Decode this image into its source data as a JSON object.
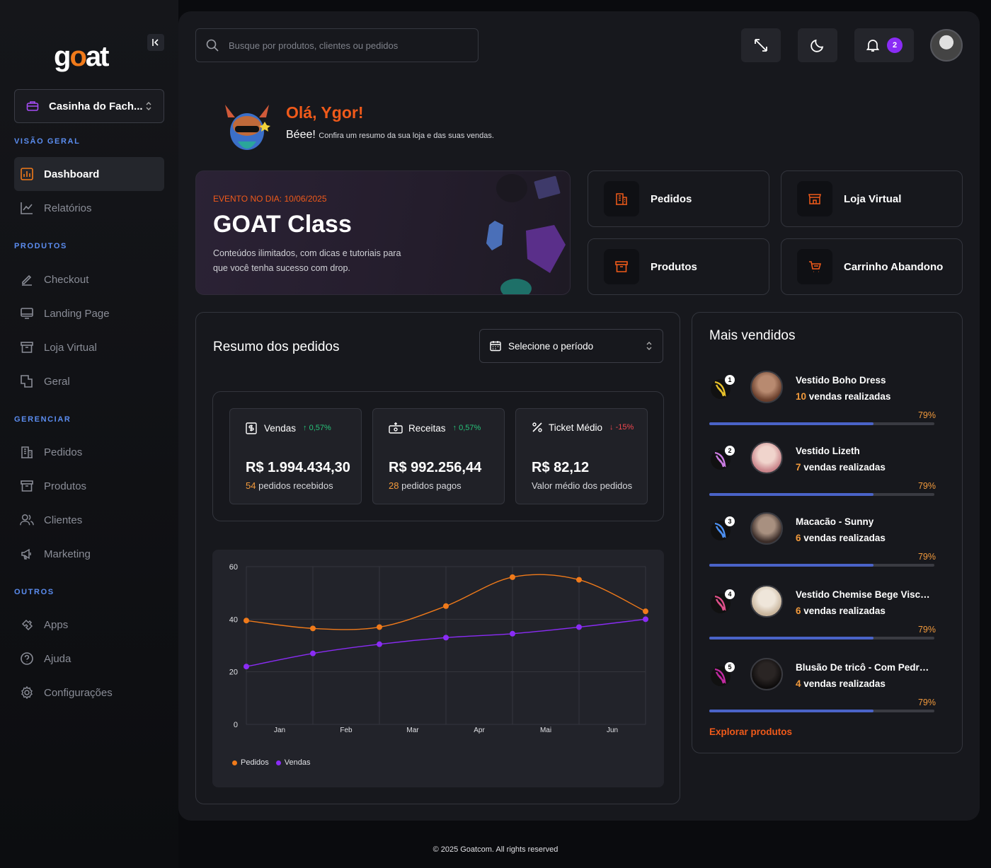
{
  "brand": {
    "logo_text": "goat",
    "logo_prefix": "g",
    "logo_o": "o",
    "logo_suffix": "at"
  },
  "store": {
    "name": "Casinha do Fach..."
  },
  "sidebar": {
    "sections": [
      "VISÃO GERAL",
      "PRODUTOS",
      "GERENCIAR",
      "OUTROS"
    ],
    "items": [
      {
        "label": "Dashboard",
        "icon": "bar-chart-icon"
      },
      {
        "label": "Relatórios",
        "icon": "line-chart-icon"
      },
      {
        "label": "Checkout",
        "icon": "pen-icon"
      },
      {
        "label": "Landing Page",
        "icon": "monitor-icon"
      },
      {
        "label": "Loja Virtual",
        "icon": "archive-icon"
      },
      {
        "label": "Geral",
        "icon": "squares-icon"
      },
      {
        "label": "Pedidos",
        "icon": "building-icon"
      },
      {
        "label": "Produtos",
        "icon": "archive-icon"
      },
      {
        "label": "Clientes",
        "icon": "users-icon"
      },
      {
        "label": "Marketing",
        "icon": "megaphone-icon"
      },
      {
        "label": "Apps",
        "icon": "puzzle-icon"
      },
      {
        "label": "Ajuda",
        "icon": "help-icon"
      },
      {
        "label": "Configurações",
        "icon": "gear-icon"
      }
    ]
  },
  "header": {
    "search_placeholder": "Busque por produtos, clientes ou pedidos",
    "notifications": "2"
  },
  "greeting": {
    "hello": "Olá, Ygor!",
    "bee": "Béee!",
    "sub": "Confira um resumo da sua loja e das suas vendas."
  },
  "event": {
    "tag": "EVENTO NO DIA: 10/06/2025",
    "title": "GOAT Class",
    "desc": "Conteúdos ilimitados, com dicas e tutoriais para que você tenha sucesso com drop."
  },
  "quick_links": [
    "Pedidos",
    "Loja Virtual",
    "Produtos",
    "Carrinho Abandono"
  ],
  "resumo": {
    "title": "Resumo dos pedidos",
    "period_placeholder": "Selecione o período",
    "stats": [
      {
        "label": "Vendas",
        "pct": "0,57%",
        "dir": "up",
        "value": "R$ 1.994.434,30",
        "count": "54",
        "note": "pedidos recebidos"
      },
      {
        "label": "Receitas",
        "pct": "0,57%",
        "dir": "up",
        "value": "R$ 992.256,44",
        "count": "28",
        "note": "pedidos pagos"
      },
      {
        "label": "Ticket Médio",
        "pct": "-15%",
        "dir": "down",
        "value": "R$ 82,12",
        "count": "",
        "note": "Valor médio dos pedidos"
      }
    ]
  },
  "chart_data": {
    "type": "line",
    "categories": [
      "Jan",
      "Feb",
      "Mar",
      "Apr",
      "Mai",
      "Jun"
    ],
    "ylim": [
      0,
      60
    ],
    "yticks": [
      0,
      20,
      40,
      60
    ],
    "x": [
      0,
      1,
      2,
      3,
      4,
      5,
      6
    ],
    "series": [
      {
        "name": "Pedidos",
        "color": "#f07a1a",
        "values": [
          39.5,
          36.5,
          37,
          45,
          56,
          55,
          43
        ]
      },
      {
        "name": "Vendas",
        "color": "#8a2cf5",
        "values": [
          22,
          27,
          30.5,
          33,
          34.5,
          37,
          40
        ]
      }
    ],
    "legend": "bottom-left",
    "grid": true
  },
  "mais_vendidos": {
    "title": "Mais vendidos",
    "sold_suffix": "vendas realizadas",
    "items": [
      {
        "rank": "1",
        "name": "Vestido Boho Dress",
        "count": "10",
        "pct": "79%",
        "progress": 0.73,
        "rank_color": "#e6c02a"
      },
      {
        "rank": "2",
        "name": "Vestido Lizeth",
        "count": "7",
        "pct": "79%",
        "progress": 0.73,
        "rank_color": "#c97be0"
      },
      {
        "rank": "3",
        "name": "Macacão - Sunny",
        "count": "6",
        "pct": "79%",
        "progress": 0.73,
        "rank_color": "#4c8ff0"
      },
      {
        "rank": "4",
        "name": "Vestido Chemise Bege Viscose...",
        "count": "6",
        "pct": "79%",
        "progress": 0.73,
        "rank_color": "#e0508a"
      },
      {
        "rank": "5",
        "name": "Blusão De tricô - Com Pedraria",
        "count": "4",
        "pct": "79%",
        "progress": 0.73,
        "rank_color": "#c02aa0"
      }
    ],
    "explore": "Explorar produtos"
  },
  "footer": "© 2025 Goatcom. All rights reserved"
}
